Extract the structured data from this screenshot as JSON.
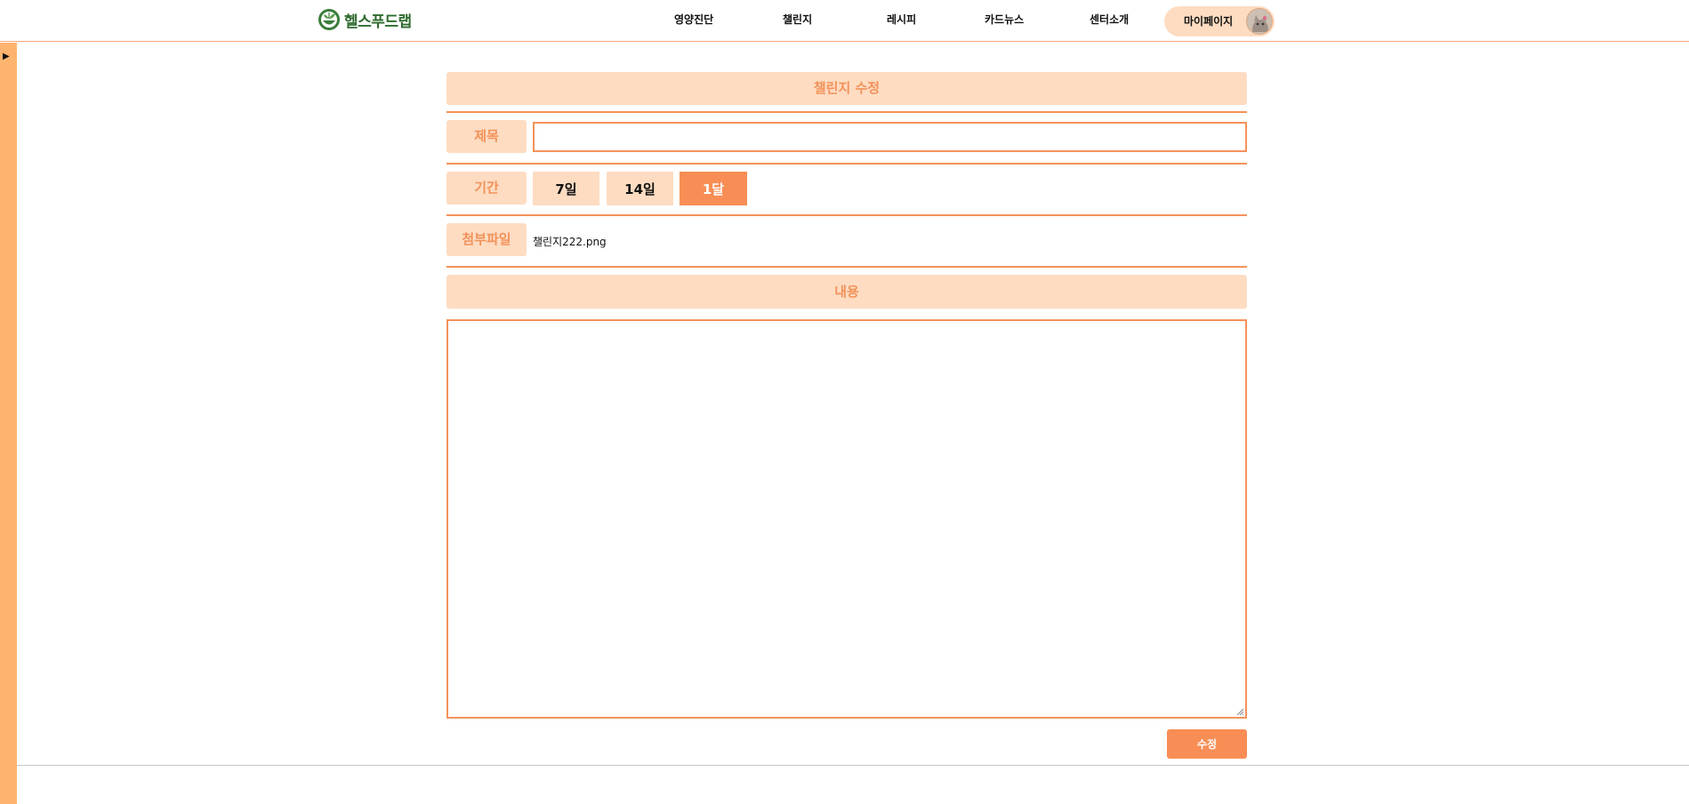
{
  "header": {
    "logo_text": "헬스푸드랩",
    "nav": [
      "영양진단",
      "챌린지",
      "레시피",
      "카드뉴스",
      "센터소개"
    ],
    "mypage_label": "마이페이지"
  },
  "sidebar": {
    "toggle_glyph": "▶"
  },
  "form": {
    "heading": "챌린지 수정",
    "title_label": "제목",
    "title_value": "",
    "period_label": "기간",
    "period_options": [
      "7일",
      "14일",
      "1달"
    ],
    "period_selected": "1달",
    "file_label": "첨부파일",
    "file_name": "챌린지222.png",
    "content_label": "내용",
    "content_value": "",
    "submit_label": "수정"
  },
  "colors": {
    "accent": "#f88e55",
    "accent_light": "#fddcc2",
    "label_text": "#f3925a",
    "side_strip": "#fdb46f",
    "logo_green": "#2f6b2f"
  },
  "icons": {
    "logo": "leaf-bowl-logo-icon",
    "avatar": "cat-avatar-icon",
    "sidebar_toggle": "play-triangle-icon",
    "resize": "resize-grip-icon"
  }
}
